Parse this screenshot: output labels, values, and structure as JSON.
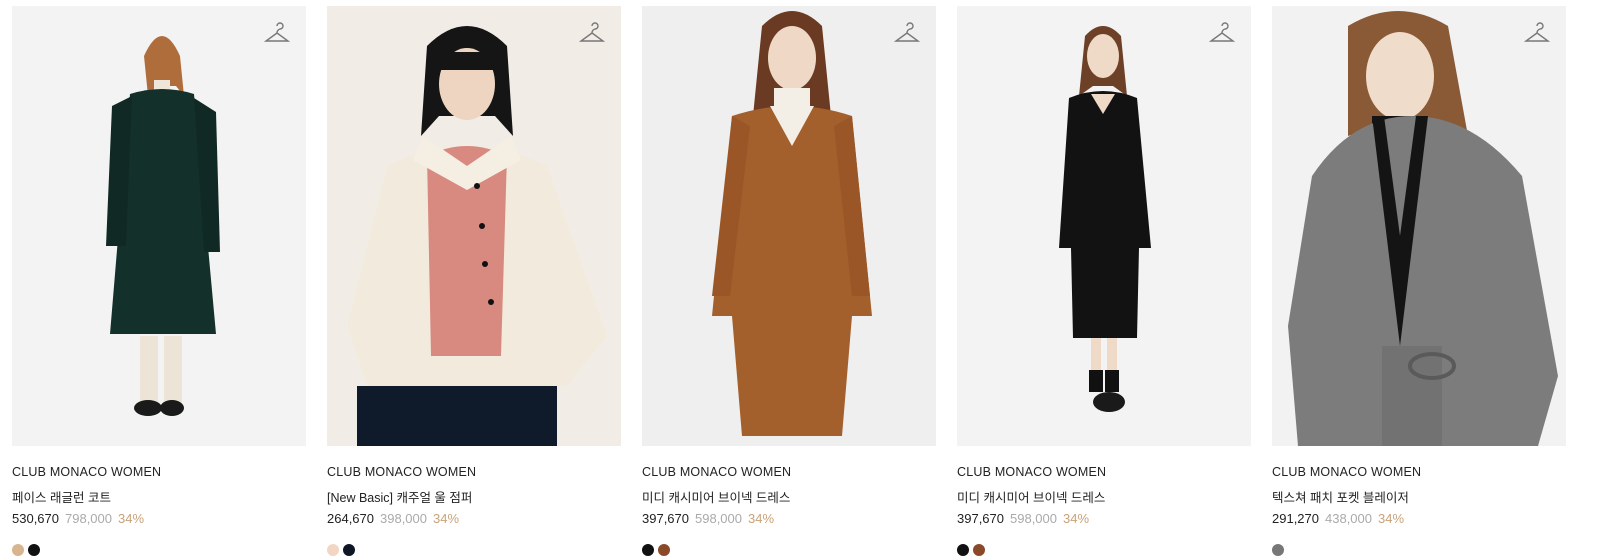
{
  "products": [
    {
      "brand": "CLUB MONACO WOMEN",
      "name": "페이스 래글런 코트",
      "price": "530,670",
      "original_price": "798,000",
      "discount": "34%",
      "swatches": [
        "#d8b48f",
        "#111111"
      ]
    },
    {
      "brand": "CLUB MONACO WOMEN",
      "name": "[New Basic] 캐주얼 울 점퍼",
      "price": "264,670",
      "original_price": "398,000",
      "discount": "34%",
      "swatches": [
        "#f2d6c4",
        "#0e1626"
      ]
    },
    {
      "brand": "CLUB MONACO WOMEN",
      "name": "미디 캐시미어 브이넥 드레스",
      "price": "397,670",
      "original_price": "598,000",
      "discount": "34%",
      "swatches": [
        "#111111",
        "#8a4a2a"
      ]
    },
    {
      "brand": "CLUB MONACO WOMEN",
      "name": "미디 캐시미어 브이넥 드레스",
      "price": "397,670",
      "original_price": "598,000",
      "discount": "34%",
      "swatches": [
        "#111111",
        "#8a4a2a"
      ]
    },
    {
      "brand": "CLUB MONACO WOMEN",
      "name": "텍스쳐 패치 포켓 블레이저",
      "price": "291,270",
      "original_price": "438,000",
      "discount": "34%",
      "swatches": [
        "#777777"
      ]
    }
  ],
  "icons": {
    "wishlist": "hanger-icon"
  },
  "colors": {
    "discount": "#c9a27a",
    "original_price": "#aaaaaa",
    "text": "#222222"
  }
}
